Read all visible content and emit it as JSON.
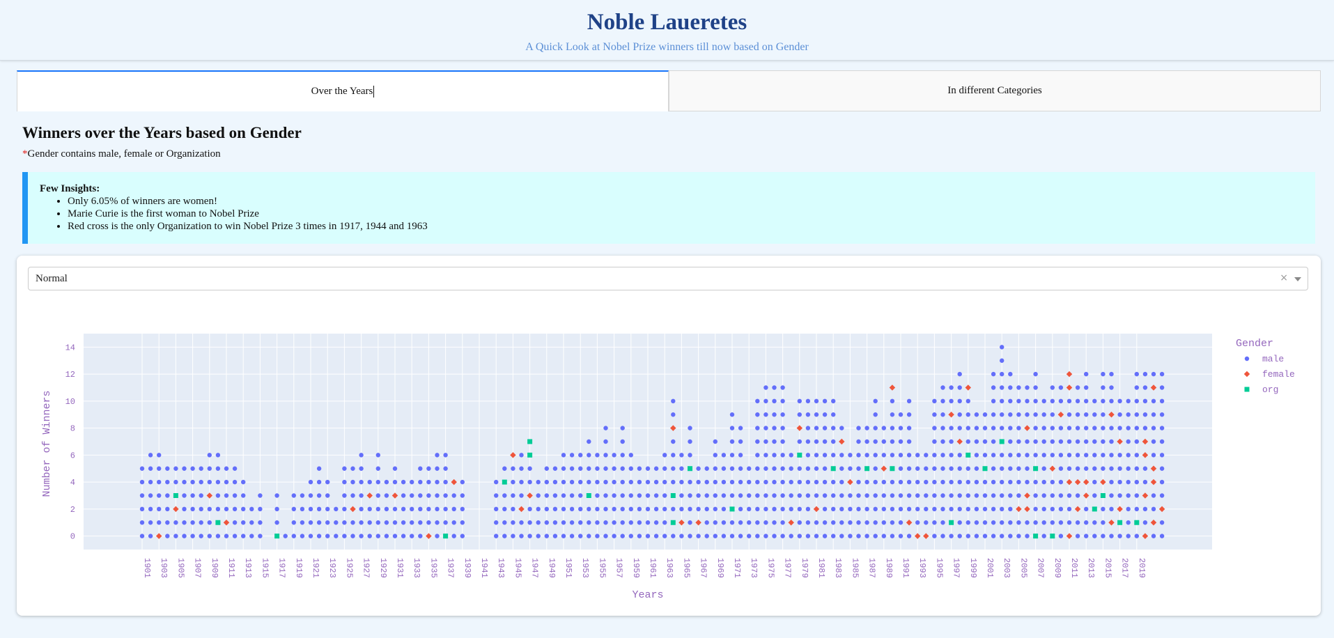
{
  "header": {
    "title": "Noble Laueretes",
    "subtitle": "A Quick Look at Nobel Prize winners till now based on Gender"
  },
  "tabs": [
    {
      "label": "Over the Years",
      "active": true
    },
    {
      "label": "In different Categories",
      "active": false
    }
  ],
  "section": {
    "title": "Winners over the Years based on Gender",
    "note_star": "*",
    "note": "Gender contains male, female or Organization"
  },
  "insights": {
    "heading": "Few Insights:",
    "items": [
      "Only 6.05% of winners are women!",
      "Marie Curie is the first woman to Nobel Prize",
      "Red cross is the only Organization to win Nobel Prize 3 times in 1917, 1944 and 1963"
    ]
  },
  "dropdown": {
    "value": "Normal",
    "clear_icon": "×"
  },
  "colors": {
    "male": "#636efa",
    "female": "#ef553b",
    "org": "#00cc96",
    "plot_bg": "#e5ecf6",
    "axis_text": "#9467bd"
  },
  "chart_data": {
    "type": "scatter",
    "xlabel": "Years",
    "ylabel": "Number of Winners",
    "ylim": [
      -1,
      15
    ],
    "yticks": [
      0,
      2,
      4,
      6,
      8,
      10,
      12,
      14
    ],
    "xlim": [
      1901,
      2021
    ],
    "xtick_start": 1901,
    "xtick_end": 2020,
    "legend": {
      "title": "Gender",
      "position": "right",
      "entries": [
        {
          "label": "male",
          "symbol": "circle"
        },
        {
          "label": "female",
          "symbol": "diamond"
        },
        {
          "label": "org",
          "symbol": "square"
        }
      ]
    },
    "columns": [
      [
        1901,
        6,
        "",
        ""
      ],
      [
        1902,
        7,
        "",
        ""
      ],
      [
        1903,
        7,
        "0",
        ""
      ],
      [
        1904,
        6,
        "",
        ""
      ],
      [
        1905,
        6,
        "2",
        "3"
      ],
      [
        1906,
        6,
        "",
        ""
      ],
      [
        1907,
        6,
        "",
        ""
      ],
      [
        1908,
        6,
        "",
        ""
      ],
      [
        1909,
        7,
        "3",
        ""
      ],
      [
        1910,
        7,
        "",
        "1"
      ],
      [
        1911,
        6,
        "1",
        ""
      ],
      [
        1912,
        6,
        "",
        ""
      ],
      [
        1913,
        5,
        "",
        ""
      ],
      [
        1914,
        3,
        "",
        ""
      ],
      [
        1915,
        4,
        "",
        ""
      ],
      [
        1916,
        0,
        "",
        ""
      ],
      [
        1917,
        4,
        "",
        "0"
      ],
      [
        1918,
        1,
        "",
        ""
      ],
      [
        1919,
        4,
        "",
        ""
      ],
      [
        1920,
        4,
        "",
        ""
      ],
      [
        1921,
        5,
        "",
        ""
      ],
      [
        1922,
        6,
        "",
        ""
      ],
      [
        1923,
        5,
        "",
        ""
      ],
      [
        1924,
        3,
        "",
        ""
      ],
      [
        1925,
        6,
        "",
        ""
      ],
      [
        1926,
        6,
        "2",
        ""
      ],
      [
        1927,
        7,
        "",
        ""
      ],
      [
        1928,
        5,
        "3",
        ""
      ],
      [
        1929,
        7,
        "",
        ""
      ],
      [
        1930,
        5,
        "",
        ""
      ],
      [
        1931,
        6,
        "3",
        ""
      ],
      [
        1932,
        5,
        "",
        ""
      ],
      [
        1933,
        5,
        "",
        ""
      ],
      [
        1934,
        6,
        "",
        ""
      ],
      [
        1935,
        6,
        "0",
        ""
      ],
      [
        1936,
        7,
        "",
        ""
      ],
      [
        1937,
        7,
        "",
        "0"
      ],
      [
        1938,
        5,
        "4",
        ""
      ],
      [
        1939,
        5,
        "",
        ""
      ],
      [
        1940,
        0,
        "",
        ""
      ],
      [
        1943,
        5,
        "",
        ""
      ],
      [
        1944,
        6,
        "",
        "4"
      ],
      [
        1945,
        7,
        "6",
        ""
      ],
      [
        1946,
        7,
        "2",
        ""
      ],
      [
        1947,
        8,
        "3",
        "6,7"
      ],
      [
        1948,
        5,
        "",
        ""
      ],
      [
        1949,
        6,
        "",
        ""
      ],
      [
        1950,
        6,
        "",
        ""
      ],
      [
        1951,
        7,
        "",
        ""
      ],
      [
        1952,
        7,
        "",
        ""
      ],
      [
        1953,
        7,
        "",
        ""
      ],
      [
        1954,
        8,
        "",
        "3"
      ],
      [
        1955,
        7,
        "",
        ""
      ],
      [
        1956,
        9,
        "",
        ""
      ],
      [
        1957,
        7,
        "",
        ""
      ],
      [
        1958,
        9,
        "",
        ""
      ],
      [
        1959,
        7,
        "",
        ""
      ],
      [
        1960,
        6,
        "",
        ""
      ],
      [
        1961,
        6,
        "",
        ""
      ],
      [
        1962,
        6,
        "",
        ""
      ],
      [
        1963,
        7,
        "",
        ""
      ],
      [
        1964,
        11,
        "8",
        "1,3"
      ],
      [
        1965,
        7,
        "1",
        ""
      ],
      [
        1966,
        9,
        "",
        "5"
      ],
      [
        1967,
        6,
        "1",
        ""
      ],
      [
        1968,
        6,
        "",
        ""
      ],
      [
        1969,
        8,
        "",
        ""
      ],
      [
        1970,
        7,
        "",
        ""
      ],
      [
        1971,
        10,
        "",
        "2"
      ],
      [
        1972,
        9,
        "",
        ""
      ],
      [
        1973,
        6,
        "",
        ""
      ],
      [
        1974,
        11,
        "",
        ""
      ],
      [
        1975,
        12,
        "",
        ""
      ],
      [
        1976,
        12,
        "",
        ""
      ],
      [
        1977,
        12,
        "",
        ""
      ],
      [
        1978,
        7,
        "1",
        ""
      ],
      [
        1979,
        11,
        "8",
        "6"
      ],
      [
        1980,
        11,
        "",
        ""
      ],
      [
        1981,
        11,
        "2",
        ""
      ],
      [
        1982,
        11,
        "",
        ""
      ],
      [
        1983,
        11,
        "",
        "5"
      ],
      [
        1984,
        9,
        "7",
        ""
      ],
      [
        1985,
        7,
        "4",
        ""
      ],
      [
        1986,
        9,
        "",
        ""
      ],
      [
        1987,
        9,
        "",
        "5"
      ],
      [
        1988,
        11,
        "",
        ""
      ],
      [
        1989,
        9,
        "5",
        ""
      ],
      [
        1990,
        12,
        "11",
        "5"
      ],
      [
        1991,
        10,
        "",
        ""
      ],
      [
        1992,
        11,
        "1",
        ""
      ],
      [
        1993,
        7,
        "0",
        ""
      ],
      [
        1994,
        7,
        "0",
        ""
      ],
      [
        1995,
        11,
        "",
        ""
      ],
      [
        1996,
        12,
        "",
        ""
      ],
      [
        1997,
        12,
        "9",
        "1"
      ],
      [
        1998,
        13,
        "7",
        ""
      ],
      [
        1999,
        12,
        "11",
        "6"
      ],
      [
        2000,
        10,
        "",
        ""
      ],
      [
        2001,
        10,
        "",
        "5"
      ],
      [
        2002,
        13,
        "",
        ""
      ],
      [
        2003,
        15,
        "",
        "7"
      ],
      [
        2004,
        13,
        "",
        ""
      ],
      [
        2005,
        12,
        "2",
        ""
      ],
      [
        2006,
        12,
        "3,8,2",
        ""
      ],
      [
        2007,
        13,
        "",
        "0,5"
      ],
      [
        2008,
        11,
        "",
        ""
      ],
      [
        2009,
        12,
        "5",
        "0"
      ],
      [
        2010,
        12,
        "9",
        ""
      ],
      [
        2011,
        13,
        "0,4,12,11",
        ""
      ],
      [
        2012,
        12,
        "2,4",
        ""
      ],
      [
        2013,
        13,
        "3,4",
        ""
      ],
      [
        2014,
        11,
        "",
        "2"
      ],
      [
        2015,
        13,
        "4",
        "3"
      ],
      [
        2016,
        13,
        "1,9",
        ""
      ],
      [
        2017,
        11,
        "7,2",
        "1"
      ],
      [
        2018,
        11,
        "",
        ""
      ],
      [
        2019,
        13,
        "",
        "1"
      ],
      [
        2020,
        13,
        "7,0,3,6",
        ""
      ],
      [
        2021,
        13,
        "1,5,11,4",
        ""
      ],
      [
        2022,
        13,
        "2",
        "2"
      ]
    ]
  }
}
